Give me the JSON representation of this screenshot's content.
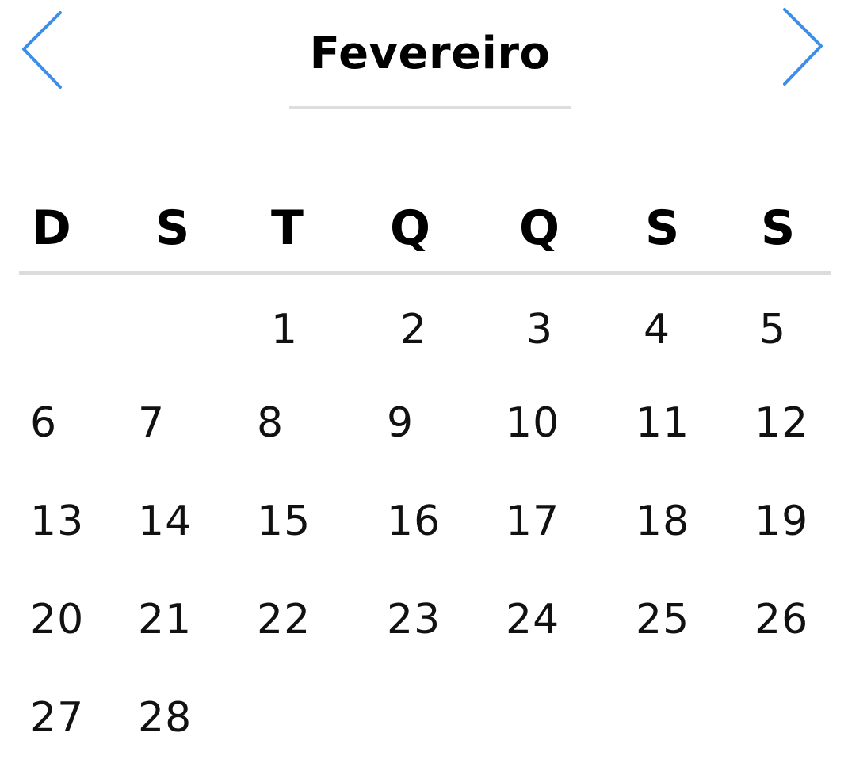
{
  "calendar": {
    "month": "Fevereiro",
    "accent_color": "#3d8ee8",
    "prev_icon": "chevron-left-icon",
    "next_icon": "chevron-right-icon",
    "weekdays": [
      "D",
      "S",
      "T",
      "Q",
      "Q",
      "S",
      "S"
    ],
    "weeks": [
      [
        "",
        "",
        "1",
        "2",
        "3",
        "4",
        "5"
      ],
      [
        "6",
        "7",
        "8",
        "9",
        "10",
        "11",
        "12"
      ],
      [
        "13",
        "14",
        "15",
        "16",
        "17",
        "18",
        "19"
      ],
      [
        "20",
        "21",
        "22",
        "23",
        "24",
        "25",
        "26"
      ],
      [
        "27",
        "28",
        "",
        "",
        "",
        "",
        ""
      ]
    ]
  }
}
